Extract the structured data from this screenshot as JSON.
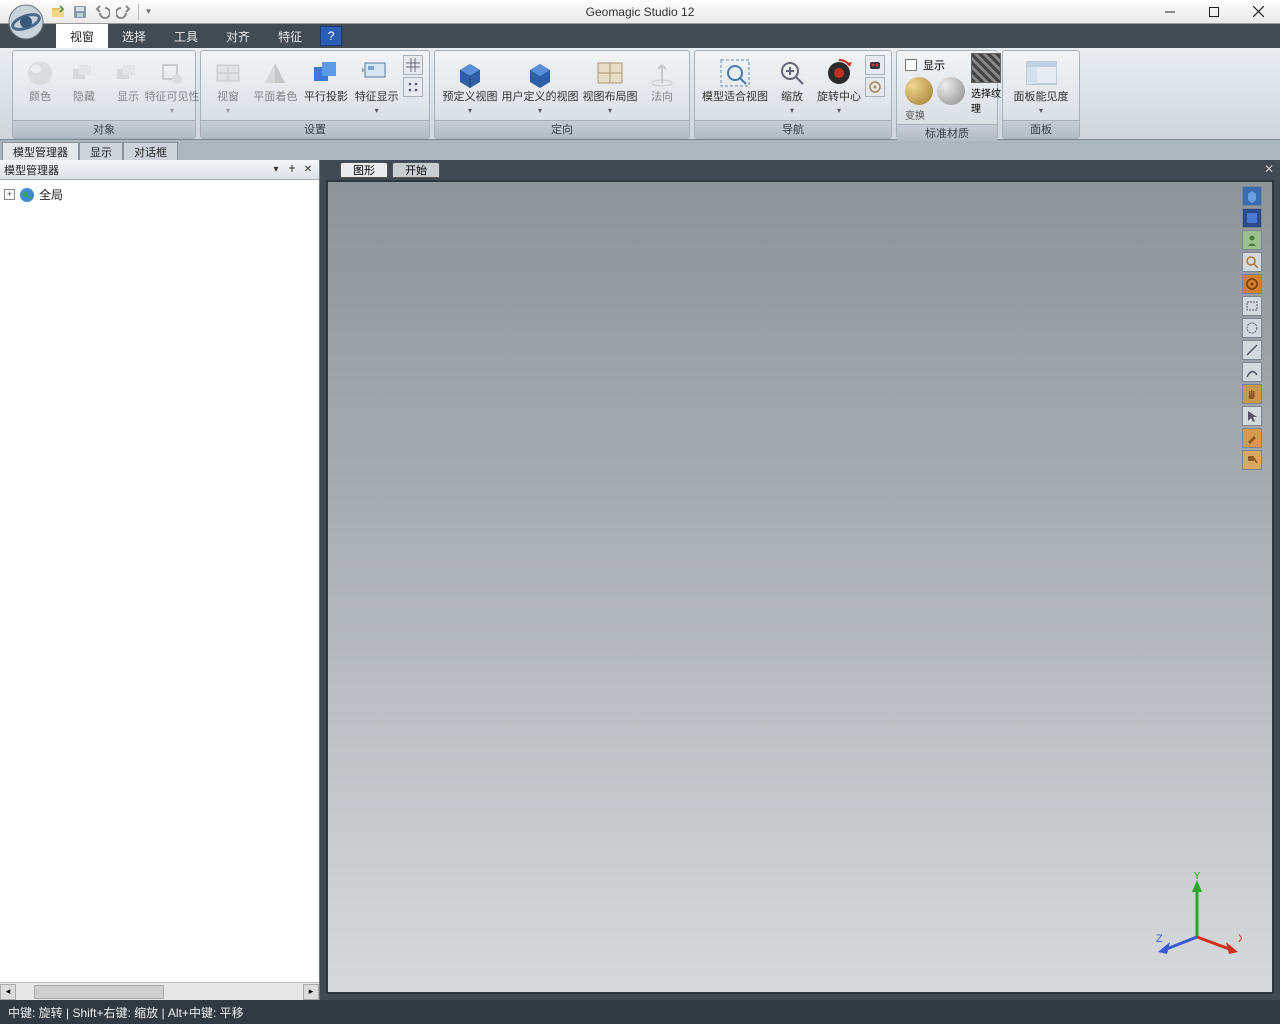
{
  "app": {
    "title": "Geomagic Studio 12"
  },
  "menu": {
    "items": [
      "视窗",
      "选择",
      "工具",
      "对齐",
      "特征"
    ],
    "active_index": 0
  },
  "ribbon": {
    "groups": [
      {
        "name": "对象",
        "buttons": [
          {
            "id": "color",
            "label": "颜色",
            "enabled": false,
            "icon": "sphere-gray"
          },
          {
            "id": "hide",
            "label": "隐藏",
            "enabled": false,
            "icon": "hide"
          },
          {
            "id": "show",
            "label": "显示",
            "enabled": false,
            "icon": "show"
          },
          {
            "id": "feature-visibility",
            "label": "特征可见性",
            "enabled": false,
            "icon": "feat-vis",
            "arrow": true
          }
        ]
      },
      {
        "name": "设置",
        "buttons": [
          {
            "id": "viewport",
            "label": "视窗",
            "enabled": false,
            "icon": "viewport",
            "arrow": true
          },
          {
            "id": "flat-shade",
            "label": "平面着色",
            "enabled": false,
            "icon": "flat-shade"
          },
          {
            "id": "parallel-proj",
            "label": "平行投影",
            "enabled": true,
            "icon": "parallel"
          },
          {
            "id": "feature-display",
            "label": "特征显示",
            "enabled": true,
            "icon": "feat-disp",
            "arrow": true
          }
        ],
        "extras": [
          "grid",
          "dots"
        ]
      },
      {
        "name": "定向",
        "buttons": [
          {
            "id": "predef-view",
            "label": "预定义视图",
            "enabled": true,
            "icon": "cube-blue",
            "arrow": true
          },
          {
            "id": "user-view",
            "label": "用户定义的视图",
            "enabled": true,
            "icon": "cube-blue2",
            "arrow": true
          },
          {
            "id": "view-layout",
            "label": "视图布局图",
            "enabled": true,
            "icon": "layout",
            "arrow": true
          },
          {
            "id": "normal",
            "label": "法向",
            "enabled": false,
            "icon": "normal"
          }
        ]
      },
      {
        "name": "导航",
        "buttons": [
          {
            "id": "fit-view",
            "label": "模型适合视图",
            "enabled": true,
            "icon": "fit"
          },
          {
            "id": "zoom",
            "label": "缩放",
            "enabled": true,
            "icon": "zoom",
            "arrow": true
          },
          {
            "id": "rotate-center",
            "label": "旋转中心",
            "enabled": true,
            "icon": "rotate-center",
            "arrow": true
          }
        ],
        "extras": [
          "record",
          "target"
        ]
      },
      {
        "name": "标准材质",
        "show_label": "显示",
        "balls": [
          "#caa24a",
          "#bdbdbd"
        ],
        "hatch_label": "选择纹理",
        "hatch": true
      },
      {
        "name": "面板",
        "buttons": [
          {
            "id": "panel-visibility",
            "label": "面板能见度",
            "enabled": true,
            "icon": "panel",
            "arrow": true
          }
        ]
      }
    ]
  },
  "left_tabs": [
    "模型管理器",
    "显示",
    "对话框"
  ],
  "left_panel": {
    "title": "模型管理器",
    "tree": [
      {
        "label": "全局",
        "icon": "globe",
        "expandable": true
      }
    ]
  },
  "viewport_tabs": [
    "图形",
    "开始"
  ],
  "axis": {
    "x": "X",
    "y": "Y",
    "z": "Z"
  },
  "statusbar": "中键: 旋转 | Shift+右键: 缩放 | Alt+中键: 平移",
  "right_tools": [
    "cube",
    "screen",
    "user",
    "search",
    "target",
    "rect",
    "circle",
    "line",
    "curve",
    "hand",
    "select",
    "brush",
    "paint"
  ]
}
